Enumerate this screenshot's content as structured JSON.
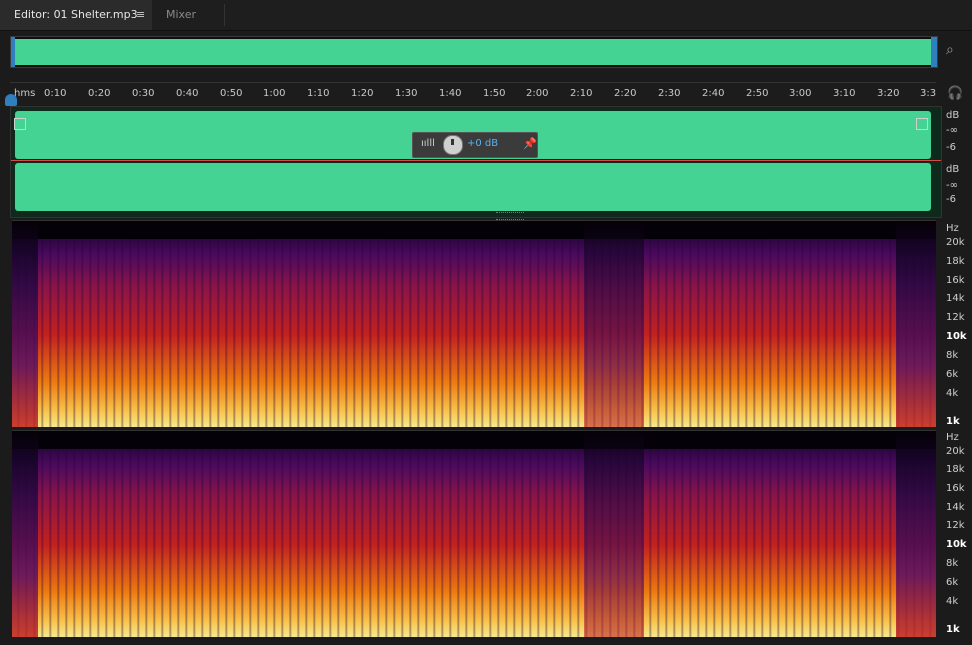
{
  "tabs": {
    "editor_label": "Editor: 01 Shelter.mp3",
    "editor_menu_icon": "≡",
    "mixer_label": "Mixer"
  },
  "overview": {
    "zoom_icon": "⌕"
  },
  "ruler": {
    "unit": "hms",
    "ticks": [
      "0:10",
      "0:20",
      "0:30",
      "0:40",
      "0:50",
      "1:00",
      "1:10",
      "1:20",
      "1:30",
      "1:40",
      "1:50",
      "2:00",
      "2:10",
      "2:20",
      "2:30",
      "2:40",
      "2:50",
      "3:00",
      "3:10",
      "3:20",
      "3:3"
    ],
    "headphone_icon": "🎧"
  },
  "hud": {
    "level_icon": "ıılll",
    "value": "+0 dB",
    "pin_icon": "📌"
  },
  "db_scale": {
    "ch1": [
      "dB",
      "-∞",
      "-6"
    ],
    "ch2": [
      "dB",
      "-∞",
      "-6"
    ]
  },
  "spectral": {
    "hz_labels": [
      "Hz",
      "20k",
      "18k",
      "16k",
      "14k",
      "12k",
      "10k",
      "8k",
      "6k",
      "4k",
      "1k"
    ]
  },
  "colors": {
    "waveform": "#45d394",
    "accent": "#2f7fbf",
    "hud_value": "#5ab2f0"
  }
}
